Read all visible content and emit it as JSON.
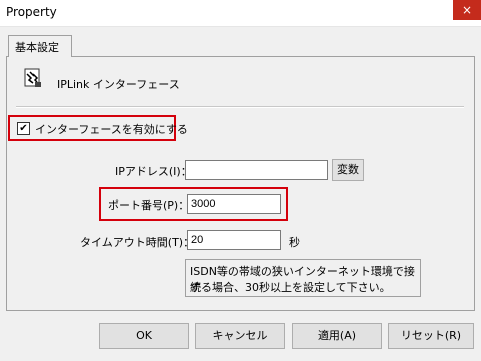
{
  "window": {
    "title": "Property",
    "close_glyph": "×"
  },
  "tabs": [
    {
      "label": "基本設定"
    }
  ],
  "header": {
    "title": "IPLink インターフェース",
    "icon": "network-interface-icon"
  },
  "enable_interface": {
    "label": "インターフェースを有効にする",
    "checked": true,
    "check_glyph": "✔"
  },
  "ip": {
    "label": "IPアドレス(I)：",
    "value": "",
    "convert_label": "変数"
  },
  "port": {
    "label": "ポート番号(P)：",
    "value": "3000"
  },
  "timeout": {
    "label": "タイムアウト時間(T)：",
    "value": "20",
    "unit": "秒"
  },
  "note": {
    "line1": "ISDN等の帯域の狭いインターネット環境で接続",
    "line2": "する場合、30秒以上を設定して下さい。"
  },
  "buttons": {
    "ok": "OK",
    "cancel": "キャンセル",
    "apply": "適用(A)",
    "reset": "リセット(R)"
  },
  "colors": {
    "highlight": "#d4000b",
    "close_button": "#c42b1c"
  }
}
